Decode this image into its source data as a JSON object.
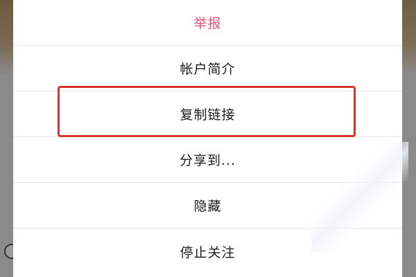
{
  "action_sheet": {
    "items": [
      {
        "label": "举报",
        "style": "danger"
      },
      {
        "label": "帐户简介",
        "style": "normal"
      },
      {
        "label": "复制链接",
        "style": "normal",
        "highlighted": true
      },
      {
        "label": "分享到...",
        "style": "normal"
      },
      {
        "label": "隐藏",
        "style": "normal"
      },
      {
        "label": "停止关注",
        "style": "normal"
      }
    ]
  },
  "colors": {
    "danger_text": "#e0546e",
    "normal_text": "#1c1c1c",
    "highlight_border": "#d9342b",
    "overlay": "#8a8a8a"
  }
}
